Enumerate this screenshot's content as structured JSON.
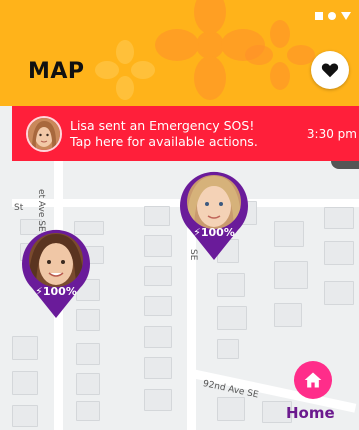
{
  "header": {
    "title": "MAP",
    "bg_color": "#ffb31a",
    "heart_button_icon": "heart-icon"
  },
  "status_bar": {
    "icons": [
      "square-icon",
      "circle-icon",
      "triangle-icon"
    ]
  },
  "sos_banner": {
    "line1": "Lisa sent an Emergency SOS!",
    "line2": "Tap here for available actions.",
    "time": "3:30 pm",
    "bg_color": "#ff1f3a"
  },
  "map": {
    "street_labels": [
      "St",
      "et Ave SE",
      "SE",
      "92nd Ave SE"
    ],
    "markers": [
      {
        "name": "girl-1",
        "battery": "100%"
      },
      {
        "name": "girl-2",
        "battery": "100%"
      }
    ],
    "marker_color": "#6a1b9a"
  },
  "home": {
    "label": "Home",
    "button_color": "#ff2d8a",
    "label_color": "#6b1a8e"
  }
}
